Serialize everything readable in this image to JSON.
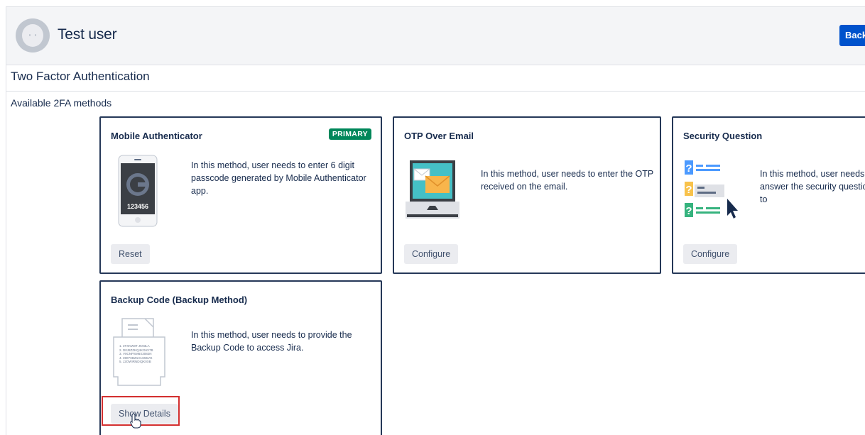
{
  "header": {
    "user_name": "Test user",
    "back_button_label": "Back"
  },
  "section_title": "Two Factor Authentication",
  "subsection_title": "Available 2FA methods",
  "methods": [
    {
      "title": "Mobile Authenticator",
      "badge": "PRIMARY",
      "description": "In this method, user needs to enter 6 digit passcode generated by Mobile Authenticator app.",
      "illustration_code": "123456",
      "icon": "mobile-phone-icon",
      "button_label": "Reset"
    },
    {
      "title": "OTP Over Email",
      "description": "In this method, user needs to enter the OTP received on the email.",
      "icon": "laptop-email-icon",
      "button_label": "Configure"
    },
    {
      "title": "Security Question",
      "description": "In this method, user needs to answer the security questions to",
      "icon": "question-list-icon",
      "button_label": "Configure"
    },
    {
      "title": "Backup Code (Backup Method)",
      "description": "In this method, user needs to provide the Backup Code to access Jira.",
      "illustration_codes": [
        "1. 3TXKW0T JK93LA",
        "2. D0J8ZZKQ4KG6X7B",
        "3. V0CNPSM6X3082N",
        "4. 3907XBZ1H1S55VG",
        "5. J2OWIRNDIQK0XB"
      ],
      "icon": "document-codes-icon",
      "button_label": "Show Details"
    }
  ],
  "colors": {
    "primary_blue": "#0052cc",
    "success_green": "#00875a",
    "card_border": "#253858",
    "highlight_red": "#d32f2f"
  }
}
